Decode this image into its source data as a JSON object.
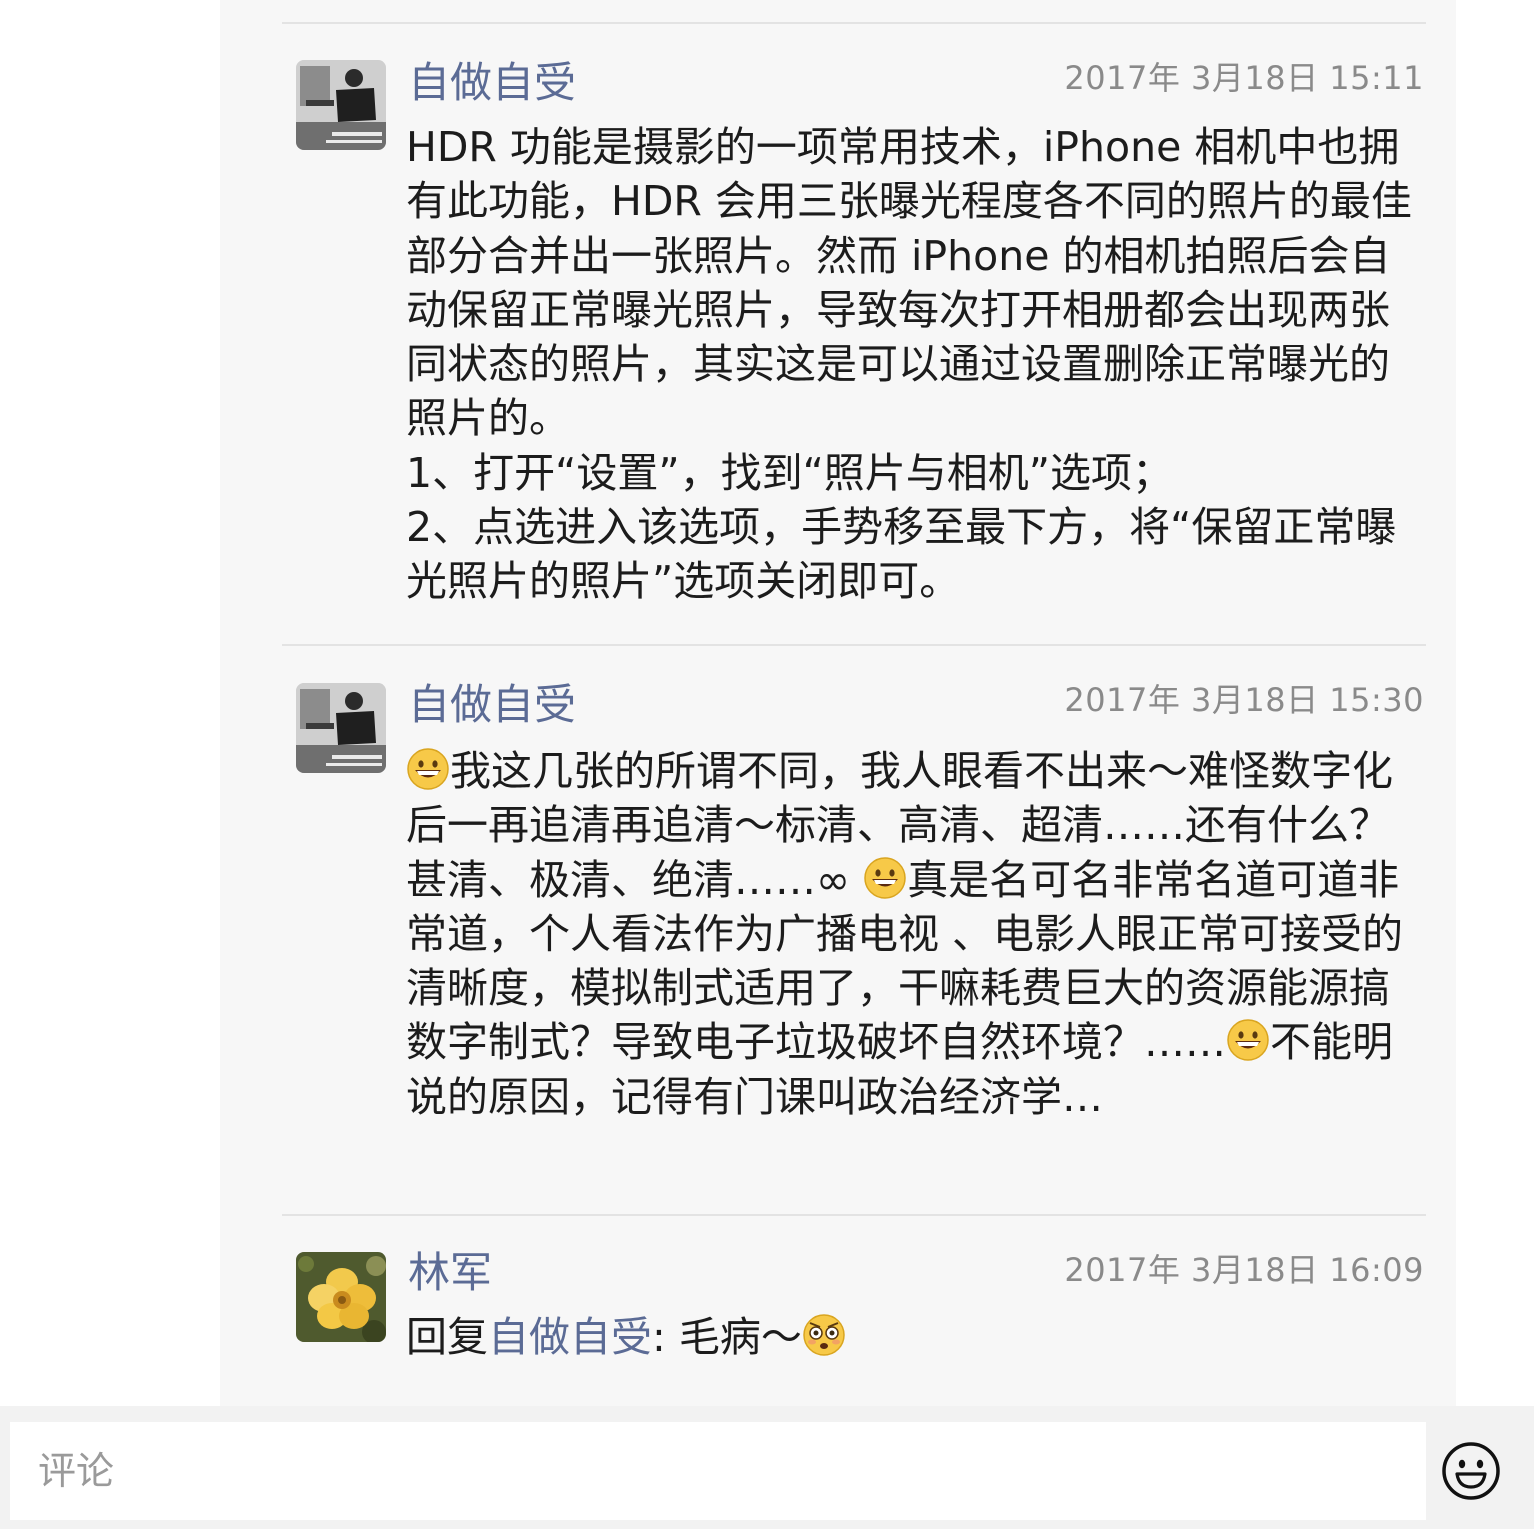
{
  "comments": [
    {
      "author": "自做自受",
      "timestamp": "2017年 3月18日 15:11",
      "text": "HDR 功能是摄影的一项常用技术，iPhone 相机中也拥有此功能，HDR 会用三张曝光程度各不同的照片的最佳部分合并出一张照片。然而 iPhone 的相机拍照后会自动保留正常曝光照片，导致每次打开相册都会出现两张同状态的照片，其实这是可以通过设置删除正常曝光的照片的。\n1、打开“设置”，找到“照片与相机”选项；\n2、点选进入该选项，手势移至最下方，将“保留正常曝光照片的照片”选项关闭即可。",
      "avatar_icon": "photographer-avatar"
    },
    {
      "author": "自做自受",
      "timestamp": "2017年 3月18日 15:30",
      "text_parts": [
        "我这几张的所谓不同，我人眼看不出来～难怪数字化后一再追清再追清～标清、高清、超清……还有什么？甚清、极清、绝清……∞ ",
        "真是名可名非常名道可道非常道，个人看法作为广播电视 、电影人眼正常可接受的清晰度，模拟制式适用了，干嘛耗费巨大的资源能源搞数字制式？导致电子垃圾破坏自然环境？……",
        "不能明说的原因，记得有门课叫政治经济学…"
      ],
      "emoji": "grinning-face-emoji",
      "avatar_icon": "photographer-avatar"
    },
    {
      "author": "林军",
      "timestamp": "2017年 3月18日 16:09",
      "reply_prefix": "回复",
      "reply_to": "自做自受",
      "reply_text": ": 毛病～",
      "emoji": "flushed-face-emoji",
      "avatar_icon": "yellow-flower-avatar"
    }
  ],
  "input": {
    "placeholder": "评论",
    "emoji_button_icon": "smiley-icon"
  },
  "colors": {
    "author": "#5b6b95",
    "text": "#1c1c1c",
    "timestamp": "#8a8a8a",
    "panel": "#f7f7f7"
  }
}
